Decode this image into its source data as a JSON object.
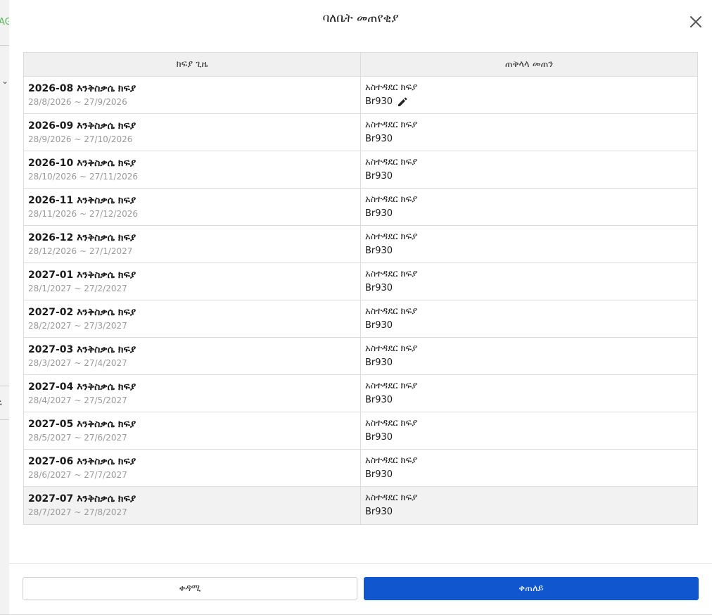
{
  "background": {
    "fragment_top": "AG",
    "fragment_mid": "ፍ"
  },
  "modal": {
    "title": "ባለቤት መጠየቂያ",
    "columns": [
      "ክፍያ ጊዜ",
      "ጠቅላላ መጠን"
    ],
    "rows": [
      {
        "title": "2026-08 እንቅስቃሴ ክፍያ",
        "range": "28/8/2026 ~ 27/9/2026",
        "fee_label": "አስተዳደር ክፍያ",
        "amount": "Br930",
        "editable": true
      },
      {
        "title": "2026-09 እንቅስቃሴ ክፍያ",
        "range": "28/9/2026 ~ 27/10/2026",
        "fee_label": "አስተዳደር ክፍያ",
        "amount": "Br930"
      },
      {
        "title": "2026-10 እንቅስቃሴ ክፍያ",
        "range": "28/10/2026 ~ 27/11/2026",
        "fee_label": "አስተዳደር ክፍያ",
        "amount": "Br930"
      },
      {
        "title": "2026-11 እንቅስቃሴ ክፍያ",
        "range": "28/11/2026 ~ 27/12/2026",
        "fee_label": "አስተዳደር ክፍያ",
        "amount": "Br930"
      },
      {
        "title": "2026-12 እንቅስቃሴ ክፍያ",
        "range": "28/12/2026 ~ 27/1/2027",
        "fee_label": "አስተዳደር ክፍያ",
        "amount": "Br930"
      },
      {
        "title": "2027-01 እንቅስቃሴ ክፍያ",
        "range": "28/1/2027 ~ 27/2/2027",
        "fee_label": "አስተዳደር ክፍያ",
        "amount": "Br930"
      },
      {
        "title": "2027-02 እንቅስቃሴ ክፍያ",
        "range": "28/2/2027 ~ 27/3/2027",
        "fee_label": "አስተዳደር ክፍያ",
        "amount": "Br930"
      },
      {
        "title": "2027-03 እንቅስቃሴ ክፍያ",
        "range": "28/3/2027 ~ 27/4/2027",
        "fee_label": "አስተዳደር ክፍያ",
        "amount": "Br930"
      },
      {
        "title": "2027-04 እንቅስቃሴ ክፍያ",
        "range": "28/4/2027 ~ 27/5/2027",
        "fee_label": "አስተዳደር ክፍያ",
        "amount": "Br930"
      },
      {
        "title": "2027-05 እንቅስቃሴ ክፍያ",
        "range": "28/5/2027 ~ 27/6/2027",
        "fee_label": "አስተዳደር ክፍያ",
        "amount": "Br930"
      },
      {
        "title": "2027-06 እንቅስቃሴ ክፍያ",
        "range": "28/6/2027 ~ 27/7/2027",
        "fee_label": "አስተዳደር ክፍያ",
        "amount": "Br930"
      },
      {
        "title": "2027-07 እንቅስቃሴ ክፍያ",
        "range": "28/7/2027 ~ 27/8/2027",
        "fee_label": "አስተዳደር ክፍያ",
        "amount": "Br930",
        "highlighted": true
      }
    ],
    "footer": {
      "prev_label": "ቀዳሚ",
      "next_label": "ቀጠለይ"
    },
    "icons": {
      "close": "close-icon",
      "edit": "pencil-icon"
    },
    "colors": {
      "primary": "#0f56cf",
      "row_highlight": "#f2f2f2",
      "muted_text": "#9a9a9a"
    }
  }
}
